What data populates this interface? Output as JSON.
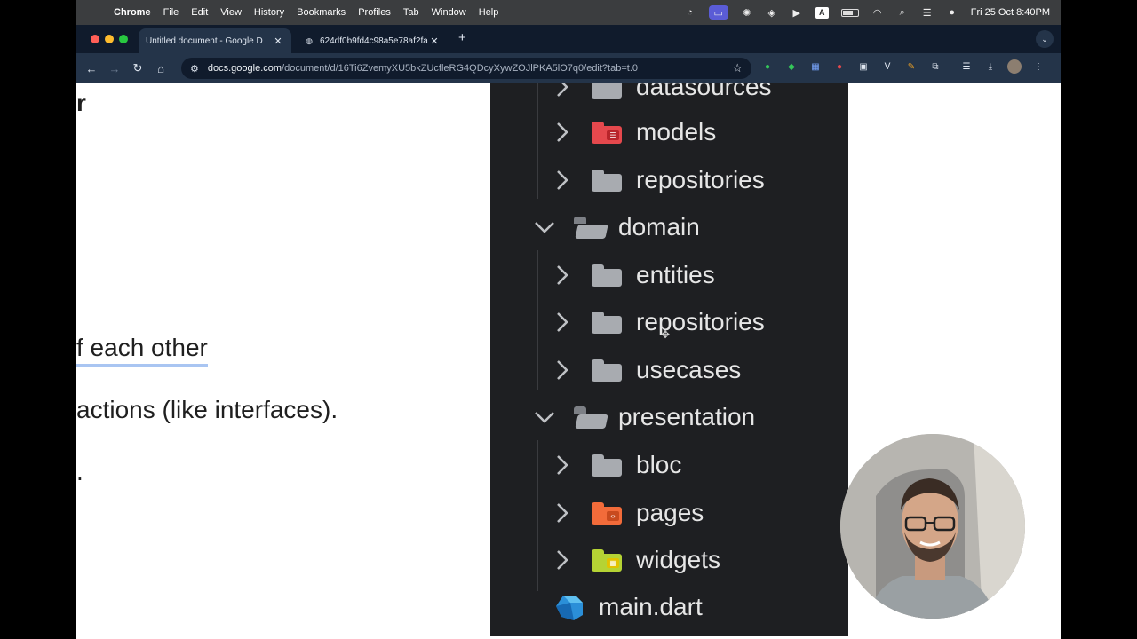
{
  "menubar": {
    "app_name": "Chrome",
    "menus": [
      "File",
      "Edit",
      "View",
      "History",
      "Bookmarks",
      "Profiles",
      "Tab",
      "Window",
      "Help"
    ],
    "input_badge": "A",
    "clock": "Fri 25 Oct  8:40PM"
  },
  "tabs": [
    {
      "title": "Untitled document - Google D",
      "active": true
    },
    {
      "title": "624df0b9fd4c98a5e78af2fa...",
      "active": false
    }
  ],
  "omnibox": {
    "host": "docs.google.com",
    "path": "/document/d/16Ti6ZvemyXU5bkZUcfleRG4QDcyXywZOJlPKA5lO7q0/edit?tab=t.0"
  },
  "doc": {
    "line1": "r",
    "line2": "f each other",
    "line3": "actions (like interfaces).",
    "line4": "."
  },
  "tree": {
    "items": [
      {
        "label": "datasources",
        "icon": "folder-icon",
        "color": "#a8abb0"
      },
      {
        "label": "models",
        "icon": "models-folder-icon",
        "color": "#e5484d"
      },
      {
        "label": "repositories",
        "icon": "folder-icon",
        "color": "#a8abb0"
      },
      {
        "label": "domain",
        "icon": "folder-open-icon",
        "color": "#a8abb0"
      },
      {
        "label": "entities",
        "icon": "folder-icon",
        "color": "#a8abb0"
      },
      {
        "label": "repositories",
        "icon": "folder-icon",
        "color": "#a8abb0"
      },
      {
        "label": "usecases",
        "icon": "folder-icon",
        "color": "#a8abb0"
      },
      {
        "label": "presentation",
        "icon": "folder-open-icon",
        "color": "#a8abb0"
      },
      {
        "label": "bloc",
        "icon": "folder-icon",
        "color": "#a8abb0"
      },
      {
        "label": "pages",
        "icon": "pages-folder-icon",
        "color": "#f26b3a"
      },
      {
        "label": "widgets",
        "icon": "widgets-folder-icon",
        "color": "#b5d334"
      },
      {
        "label": "main.dart",
        "icon": "dart-file-icon",
        "color": "#2b8fd8"
      }
    ]
  },
  "colors": {
    "accent": "#4285f4",
    "tab_strip": "#101b2c",
    "toolbar": "#243449",
    "ide_bg": "#1e1f22"
  }
}
